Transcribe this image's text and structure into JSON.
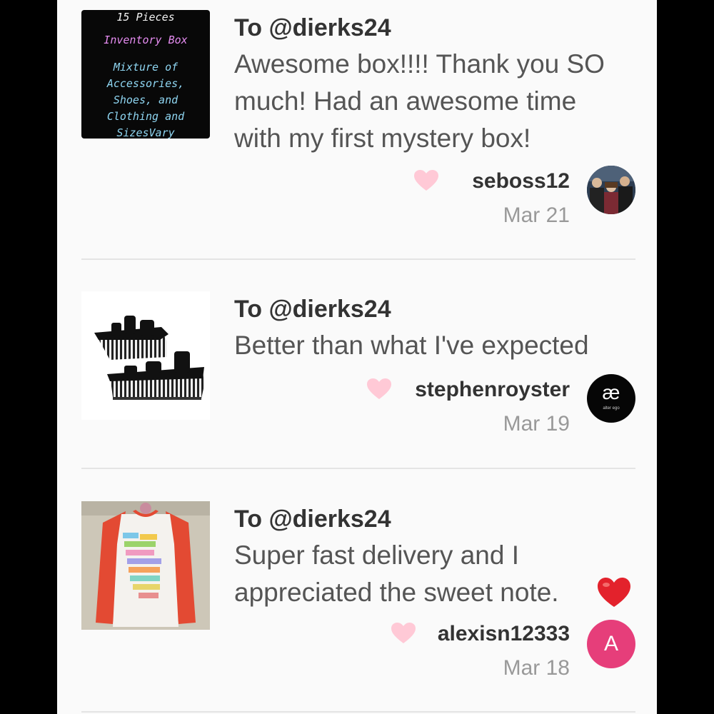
{
  "reviews": [
    {
      "to": "To @dierks24",
      "message": "Awesome box!!!! Thank you SO\nmuch! Had an awesome time\nwith my first mystery box!",
      "user": "seboss12",
      "date": "Mar 21",
      "thumb": {
        "kind": "inventory-box-image",
        "lines": [
          "15 Pieces",
          "Inventory Box",
          "Mixture of",
          "Accessories,",
          "Shoes, and",
          "Clothing and",
          "SizesVary"
        ]
      },
      "avatar": {
        "kind": "photo"
      }
    },
    {
      "to": "To @dierks24",
      "message": "Better than what I've expected",
      "user": "stephenroyster",
      "date": "Mar 19",
      "thumb": {
        "kind": "wedge-sandals-photo"
      },
      "avatar": {
        "kind": "logo",
        "glyph": "æ",
        "caption": "alter ego"
      }
    },
    {
      "to": "To @dierks24",
      "message": "Super fast delivery and I\nappreciated the sweet note.",
      "user": "alexisn12333",
      "date": "Mar 18",
      "thumb": {
        "kind": "raglan-tshirt-photo"
      },
      "avatar": {
        "kind": "letter",
        "letter": "A"
      }
    }
  ],
  "colors": {
    "like_heart": "#ffc9d6",
    "emoji_heart": "#e3222c",
    "box_title_color": "#e58cf0",
    "box_text_color": "#8fd6f2",
    "letter_avatar_bg": "#e63e7a"
  },
  "icons": {
    "like": "heart-icon",
    "emoji": "red-heart-emoji"
  }
}
